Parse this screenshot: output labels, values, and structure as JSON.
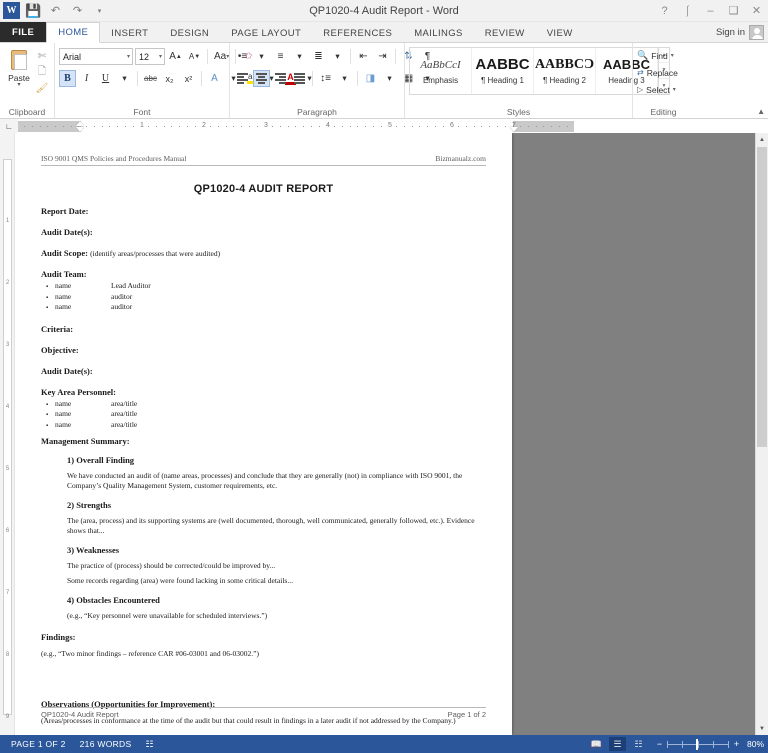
{
  "titlebar": {
    "document_title": "QP1020-4 Audit Report - Word",
    "quick_access": [
      "save-icon",
      "undo-icon",
      "redo-icon",
      "customize-qat-icon"
    ],
    "window_buttons": [
      "help",
      "ribbon-display-options",
      "minimize",
      "restore",
      "close"
    ]
  },
  "tabs": {
    "file_label": "FILE",
    "items": [
      "HOME",
      "INSERT",
      "DESIGN",
      "PAGE LAYOUT",
      "REFERENCES",
      "MAILINGS",
      "REVIEW",
      "VIEW"
    ],
    "active": "HOME",
    "sign_in_label": "Sign in"
  },
  "ribbon": {
    "clipboard": {
      "label": "Clipboard",
      "paste_label": "Paste",
      "buttons": [
        "cut-icon",
        "copy-icon",
        "format-painter-icon"
      ]
    },
    "font": {
      "label": "Font",
      "font_name": "Arial",
      "font_size": "12",
      "grow_font": "A",
      "shrink_font": "A",
      "change_case": "Aa",
      "clear_formatting": "clear-formatting-icon",
      "bold": "B",
      "italic": "I",
      "underline": "U",
      "strikethrough": "abc",
      "subscript": "x₂",
      "superscript": "x²",
      "text_effects": "A",
      "highlight": "ab",
      "font_color": "A"
    },
    "paragraph": {
      "label": "Paragraph",
      "row1": [
        "bullets-icon",
        "numbering-icon",
        "multilevel-list-icon",
        "decrease-indent-icon",
        "increase-indent-icon",
        "sort-icon",
        "show-marks-icon"
      ],
      "row2": [
        "align-left-icon",
        "align-center-icon",
        "align-right-icon",
        "justify-icon",
        "line-spacing-icon",
        "shading-icon",
        "borders-icon"
      ],
      "active_alignment": "align-center-icon"
    },
    "styles": {
      "label": "Styles",
      "items": [
        {
          "preview": "AaBbCcI",
          "name": "Emphasis"
        },
        {
          "preview": "AABBC",
          "name": "¶ Heading 1"
        },
        {
          "preview": "AABBCƆ",
          "name": "¶ Heading 2"
        },
        {
          "preview": "AABBC",
          "name": "Heading 3"
        }
      ]
    },
    "editing": {
      "label": "Editing",
      "find_label": "Find",
      "replace_label": "Replace",
      "select_label": "Select"
    }
  },
  "ruler": {
    "numbers": [
      "1",
      "2",
      "3",
      "4",
      "5",
      "6",
      "7"
    ]
  },
  "document": {
    "header_left": "ISO 9001 QMS Policies and Procedures Manual",
    "header_right": "Bizmanualz.com",
    "title": "QP1020-4 AUDIT REPORT",
    "fields": [
      {
        "label": "Report Date:",
        "note": ""
      },
      {
        "label": "Audit Date(s):",
        "note": ""
      },
      {
        "label": "Audit Scope:",
        "note": "(identify areas/processes that were audited)"
      }
    ],
    "audit_team_label": "Audit Team:",
    "audit_team": [
      {
        "name": "name",
        "role": "Lead Auditor"
      },
      {
        "name": "name",
        "role": "auditor"
      },
      {
        "name": "name",
        "role": "auditor"
      }
    ],
    "criteria_label": "Criteria:",
    "objective_label": "Objective:",
    "audit_dates_label": "Audit Date(s):",
    "key_area_label": "Key Area Personnel:",
    "key_area_personnel": [
      {
        "name": "name",
        "role": "area/title"
      },
      {
        "name": "name",
        "role": "area/title"
      },
      {
        "name": "name",
        "role": "area/title"
      }
    ],
    "management_summary_label": "Management Summary:",
    "sections": [
      {
        "heading": "1) Overall Finding",
        "paragraphs": [
          "We have conducted an audit of (name areas, processes) and conclude that they are generally (not) in compliance with ISO 9001, the Company’s Quality Management System, customer requirements, etc."
        ]
      },
      {
        "heading": "2) Strengths",
        "paragraphs": [
          "The (area, process) and its supporting systems are (well documented, thorough, well communicated, generally followed, etc.).  Evidence shows that..."
        ]
      },
      {
        "heading": "3) Weaknesses",
        "paragraphs": [
          "The practice of (process) should be corrected/could be improved by...",
          "Some records regarding (area) were found lacking in some critical details..."
        ]
      },
      {
        "heading": "4) Obstacles Encountered",
        "paragraphs": [
          "(e.g., “Key personnel were unavailable for scheduled interviews.”)"
        ]
      }
    ],
    "findings_label": "Findings:",
    "findings_text": "(e.g., “Two minor findings – reference CAR #06-03001 and 06-03002.”)",
    "observations_label": "Observations (Opportunities for Improvement):",
    "observations_text": "(Areas/processes in conformance at the time of the audit but that could result in findings in a later audit if not addressed by the Company.)",
    "footer_left": "QP1020-4 Audit Report",
    "footer_right": "Page 1 of 2"
  },
  "statusbar": {
    "page_label": "PAGE 1 OF 2",
    "word_count": "216 WORDS",
    "proofing_icon": "proofing-errors-icon",
    "views": [
      "read-mode-icon",
      "print-layout-icon",
      "web-layout-icon"
    ],
    "active_view": "print-layout-icon",
    "zoom_out": "−",
    "zoom_in": "+",
    "zoom_level": "80%"
  },
  "colors": {
    "accent": "#2b579a",
    "file_tab": "#2b2b2b",
    "doc_background": "#808080",
    "ribbon_bg": "#ffffff"
  }
}
